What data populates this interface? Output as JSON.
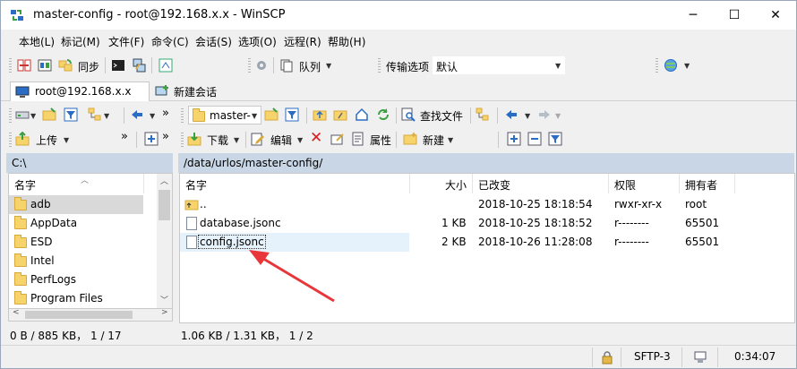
{
  "window": {
    "title": "master-config - root@192.168.x.x - WinSCP"
  },
  "menubar": [
    "本地(L)",
    "标记(M)",
    "文件(F)",
    "命令(C)",
    "会话(S)",
    "选项(O)",
    "远程(R)",
    "帮助(H)"
  ],
  "toolbar1": {
    "sync_label": "同步",
    "queue_label": "队列",
    "transfer_label": "传输选项",
    "transfer_value": "默认"
  },
  "tabs": {
    "session_label": "root@192.168.x.x",
    "new_session_label": "新建会话"
  },
  "local": {
    "upload_label": "上传",
    "path": "C:\\",
    "header_name": "名字",
    "items": [
      "adb",
      "AppData",
      "ESD",
      "Intel",
      "PerfLogs",
      "Program Files"
    ],
    "status": "0 B / 885 KB， 1 / 17"
  },
  "remote": {
    "dir_label": "master-",
    "find_label": "查找文件",
    "download_label": "下载",
    "edit_label": "编辑",
    "props_label": "属性",
    "new_label": "新建",
    "path": "/data/urlos/master-config/",
    "headers": {
      "name": "名字",
      "size": "大小",
      "changed": "已改变",
      "rights": "权限",
      "owner": "拥有者"
    },
    "rows": [
      {
        "name": "..",
        "size": "",
        "changed": "2018-10-25 18:18:54",
        "rights": "rwxr-xr-x",
        "owner": "root"
      },
      {
        "name": "database.jsonc",
        "size": "1 KB",
        "changed": "2018-10-25 18:18:52",
        "rights": "r--------",
        "owner": "65501"
      },
      {
        "name": "config.jsonc",
        "size": "2 KB",
        "changed": "2018-10-26 11:28:08",
        "rights": "r--------",
        "owner": "65501"
      }
    ],
    "status": "1.06 KB / 1.31 KB， 1 / 2"
  },
  "statusbar": {
    "protocol": "SFTP-3",
    "time": "0:34:07"
  },
  "colors": {
    "path_bar": "#c8d6e6",
    "selected_row": "#e5f1fb",
    "annotation_arrow": "#e8363a"
  }
}
